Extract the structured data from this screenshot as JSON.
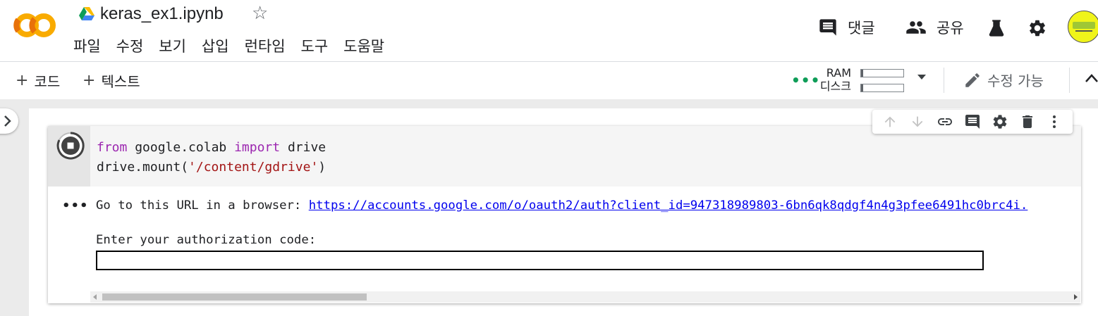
{
  "header": {
    "logo_text": "CO",
    "notebook_title": "keras_ex1.ipynb",
    "star_glyph": "☆",
    "menu": [
      "파일",
      "수정",
      "보기",
      "삽입",
      "런타임",
      "도구",
      "도움말"
    ],
    "comment_label": "댓글",
    "share_label": "공유",
    "avatar_icon": "user-avatar"
  },
  "toolbar": {
    "add_code_label": "코드",
    "add_text_label": "텍스트",
    "plus_glyph": "+",
    "connecting_dots": "•••",
    "ram_label": "RAM",
    "disk_label": "디스크",
    "ram_fill": 0.05,
    "disk_fill": 0.05,
    "edit_label": "수정 가능"
  },
  "cell": {
    "code_line1_kw1": "from",
    "code_line1_mod": " google.colab ",
    "code_line1_kw2": "import",
    "code_line1_name": " drive",
    "code_line2_pre": "drive.mount(",
    "code_line2_str": "'/content/gdrive'",
    "code_line2_post": ")",
    "output_dots": "•••",
    "output_prefix": "Go to this URL in a browser: ",
    "output_url": "https://accounts.google.com/o/oauth2/auth?client_id=947318989803-6bn6qk8qdgf4n4g3pfee6491hc0brc4i.",
    "auth_prompt": "Enter your authorization code:",
    "auth_value": ""
  },
  "colors": {
    "accent_orange": "#f9ab00",
    "logo_orange": "#e8710a",
    "status_green": "#0f9d58",
    "keyword": "#9c27b0",
    "string": "#a31515",
    "link": "#0000ee"
  }
}
